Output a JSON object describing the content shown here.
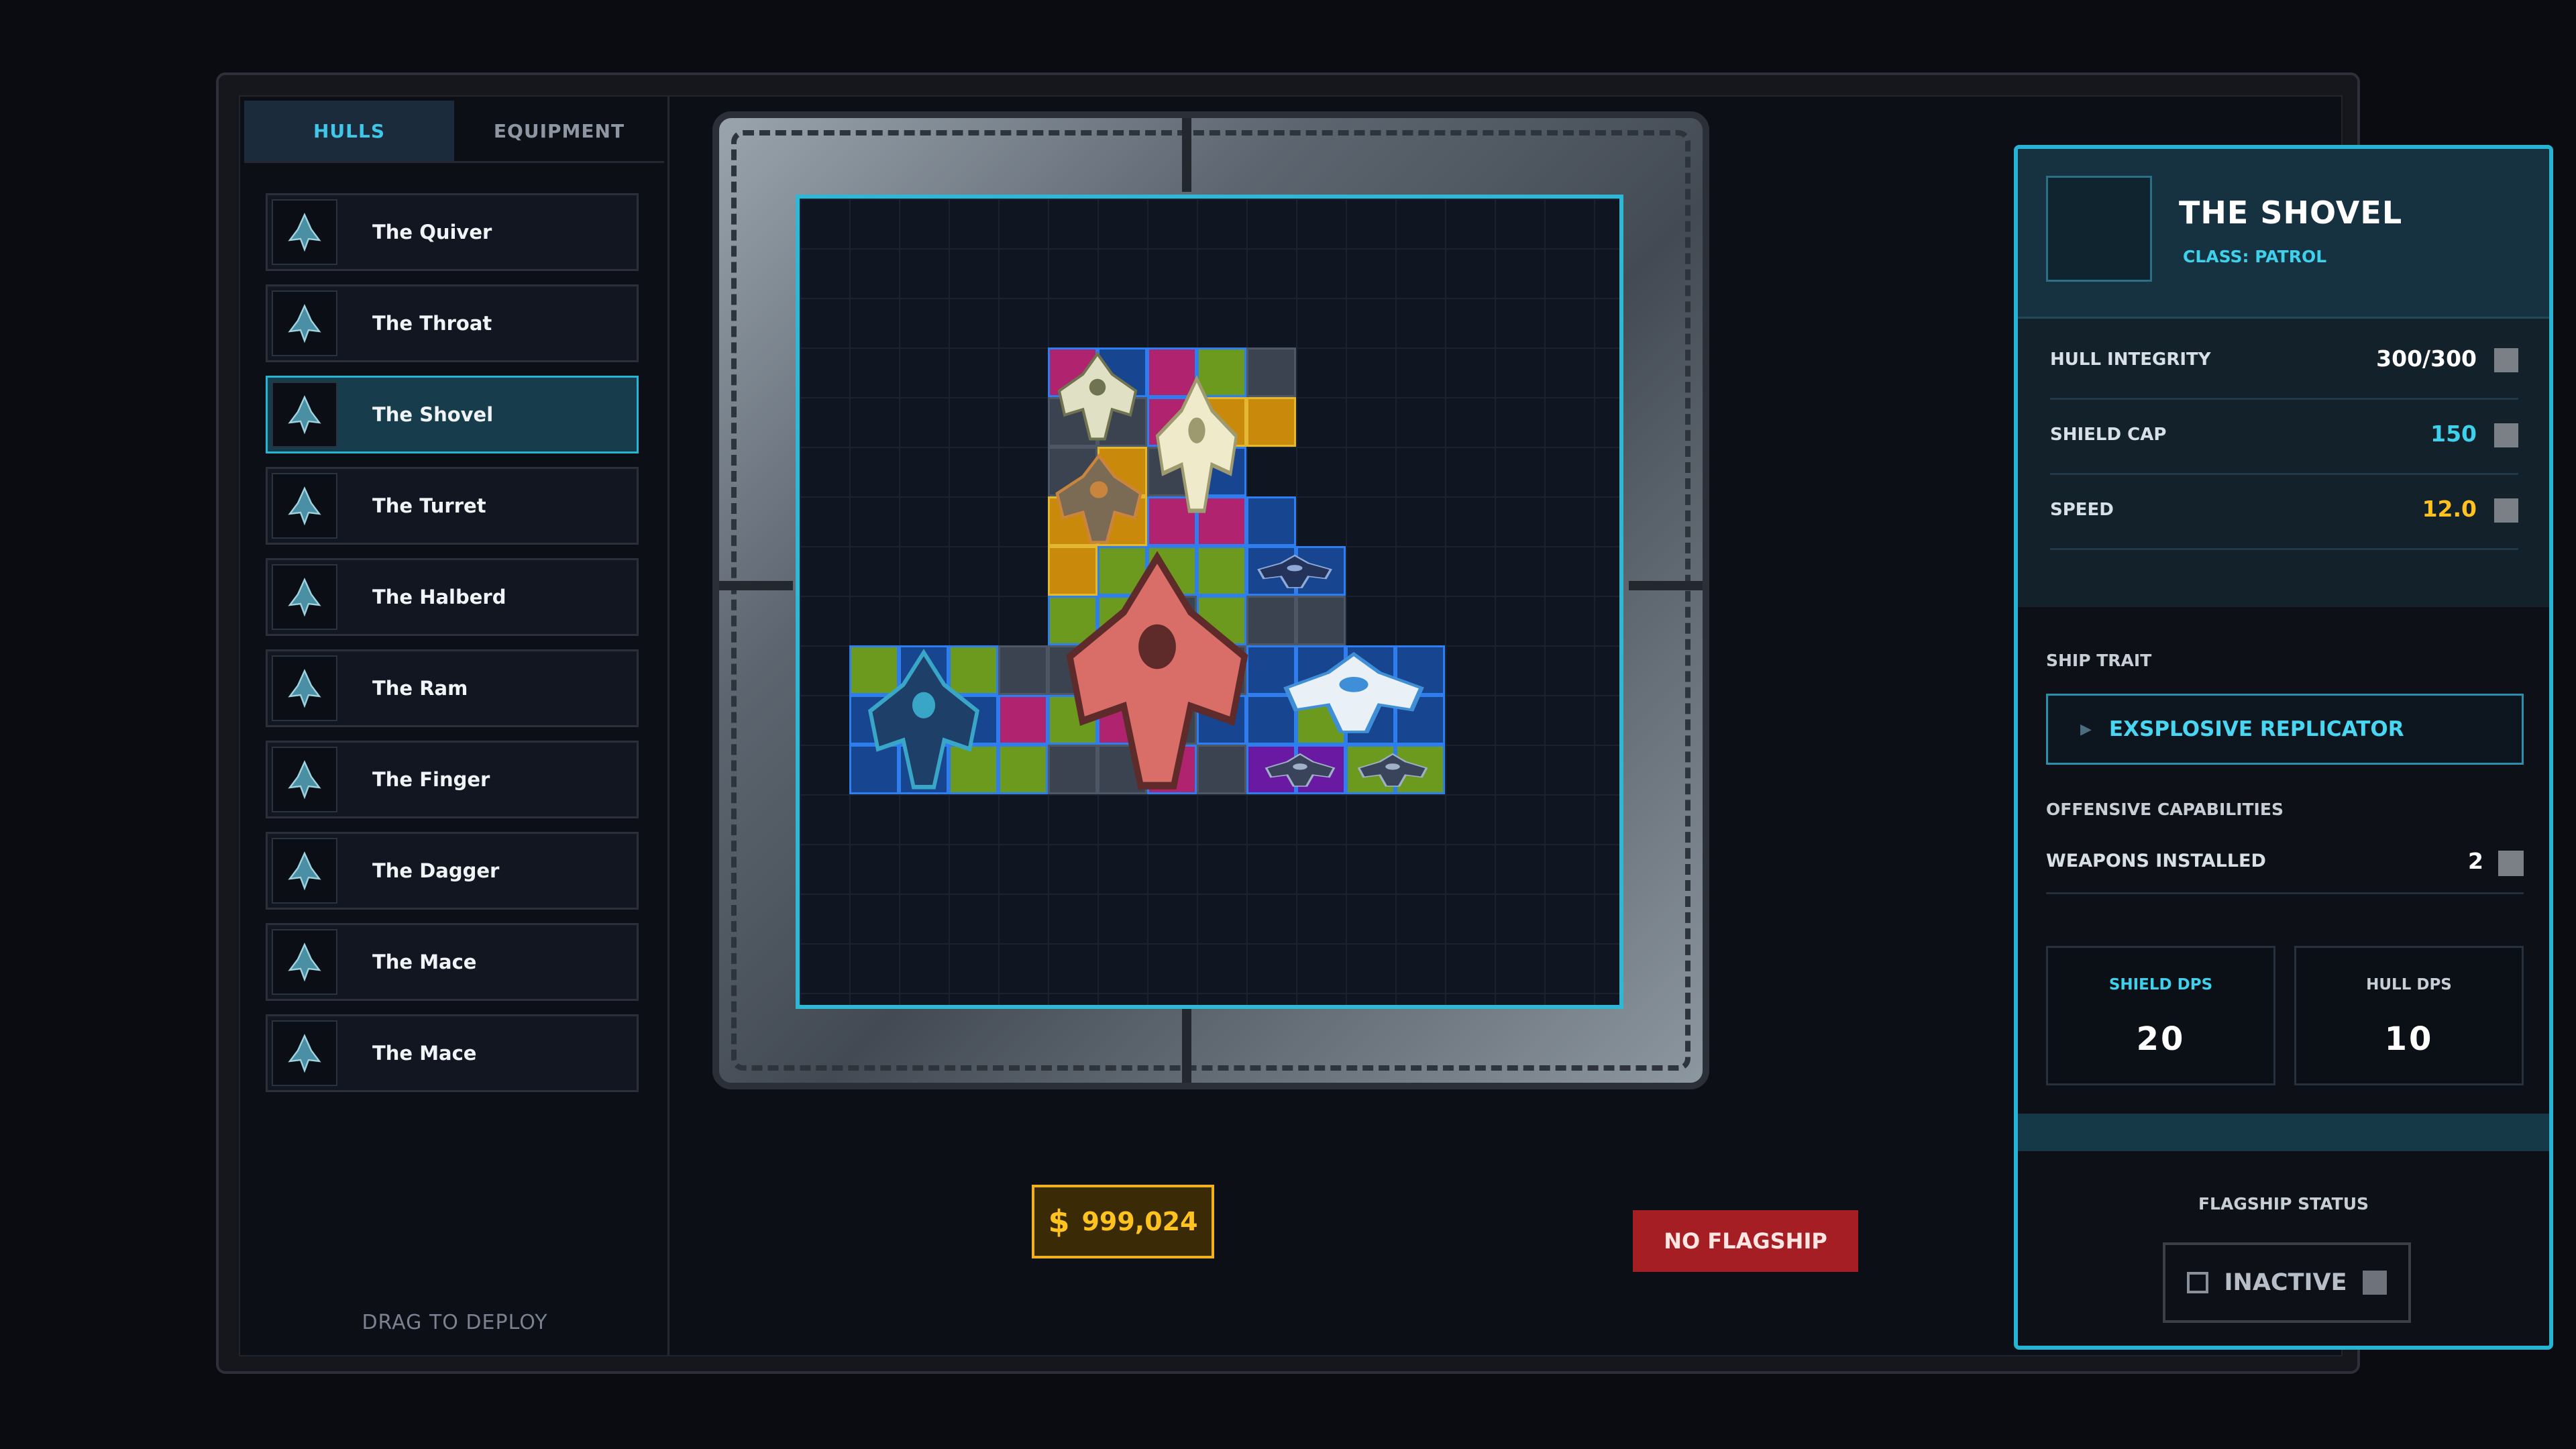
{
  "tabs": {
    "hulls": "HULLS",
    "equipment": "EQUIPMENT"
  },
  "hulls": [
    {
      "name": "The Quiver",
      "icon": "ship-icon"
    },
    {
      "name": "The Throat",
      "icon": "ship-icon"
    },
    {
      "name": "The Shovel",
      "icon": "ship-icon",
      "selected": true
    },
    {
      "name": "The Turret",
      "icon": "ship-icon"
    },
    {
      "name": "The Halberd",
      "icon": "ship-icon"
    },
    {
      "name": "The Ram",
      "icon": "ship-icon"
    },
    {
      "name": "The Finger",
      "icon": "ship-icon"
    },
    {
      "name": "The Dagger",
      "icon": "ship-icon"
    },
    {
      "name": "The Mace",
      "icon": "ship-icon"
    },
    {
      "name": "The Mace",
      "icon": "ship-icon"
    }
  ],
  "sidebar_hint": "DRAG TO DEPLOY",
  "money": {
    "symbol": "$",
    "amount": "999,024"
  },
  "flagship_button": "NO FLAGSHIP",
  "info": {
    "title": "THE SHOVEL",
    "class_label": "CLASS: PATROL",
    "stats": [
      {
        "label": "HULL INTEGRITY",
        "value": "300/300",
        "color": "#ffffff"
      },
      {
        "label": "SHIELD CAP",
        "value": "150",
        "color": "#3fd0ec"
      },
      {
        "label": "SPEED",
        "value": "12.0",
        "color": "#ffc21f"
      }
    ],
    "trait_label": "SHIP TRAIT",
    "trait": "EXSPLOSIVE REPLICATOR",
    "offensive_label": "OFFENSIVE CAPABILITIES",
    "weapons_label": "WEAPONS INSTALLED",
    "weapons_count": "2",
    "shield_dps_label": "SHIELD DPS",
    "shield_dps": "20",
    "hull_dps_label": "HULL DPS",
    "hull_dps": "10",
    "flagship_status_label": "FLAGSHIP STATUS",
    "flagship_status": "INACTIVE"
  },
  "colors": {
    "accent": "#27b4d4",
    "money": "#ffc21f",
    "danger": "#a51e23"
  }
}
